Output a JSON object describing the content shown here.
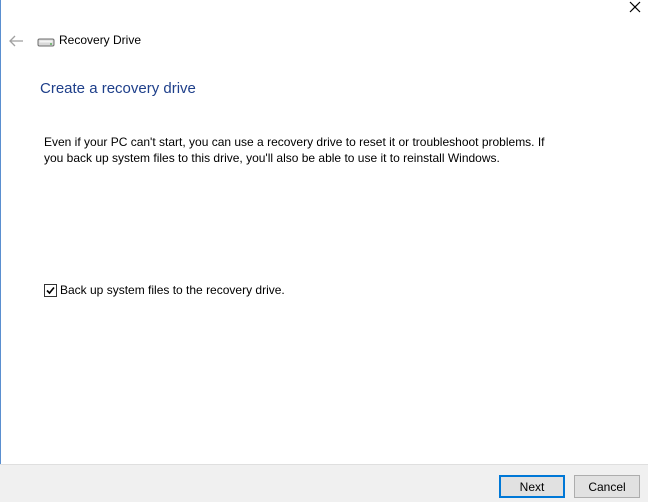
{
  "window": {
    "title": "Recovery Drive",
    "icon": "drive-icon",
    "controls": {
      "close_icon": "close-icon",
      "back_icon": "back-arrow-icon"
    }
  },
  "page": {
    "title": "Create a recovery drive",
    "description_line1": "Even if your PC can't start, you can use a recovery drive to reset it or troubleshoot problems. If",
    "description_line2": "you back up system files to this drive, you'll also be able to use it to reinstall Windows."
  },
  "options": {
    "backup_system_files": {
      "label": "Back up system files to the recovery drive.",
      "checked": true
    }
  },
  "footer": {
    "next_label": "Next",
    "cancel_label": "Cancel"
  },
  "colors": {
    "title_blue": "#1e3f8a",
    "accent": "#0078d7",
    "footer_bg": "#f0f0f0"
  }
}
